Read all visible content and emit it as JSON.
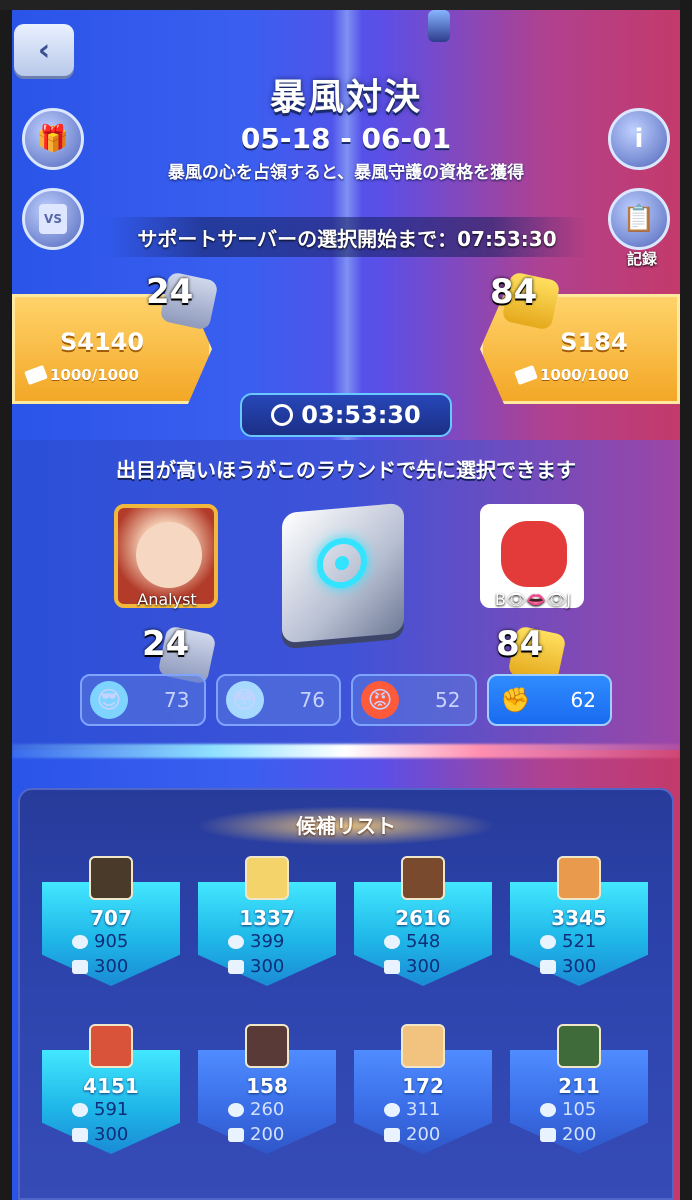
{
  "event": {
    "title": "暴風対決",
    "dates": "05-18 - 06-01",
    "subtitle": "暴風の心を占領すると、暴風守護の資格を獲得",
    "support_countdown": "サポートサーバーの選択開始まで：07:53:30",
    "record_label": "記録",
    "vs_label": "VS"
  },
  "servers": {
    "left": {
      "name": "S4140",
      "tickets": "1000/1000",
      "dice": "24"
    },
    "right": {
      "name": "S184",
      "tickets": "1000/1000",
      "dice": "84"
    }
  },
  "round_timer": "03:53:30",
  "round_note": "出目が高いほうがこのラウンドで先に選択できます",
  "players": {
    "left": {
      "name": "Analyst",
      "roll": "24"
    },
    "right": {
      "name": "B👁👄👁J",
      "roll": "84"
    }
  },
  "reactions": [
    {
      "icon": "cool-face-icon",
      "count": "73",
      "active": false
    },
    {
      "icon": "shocked-face-icon",
      "count": "76",
      "active": false
    },
    {
      "icon": "angry-face-icon",
      "count": "52",
      "active": false
    },
    {
      "icon": "fist-icon",
      "count": "62",
      "active": true
    }
  ],
  "candidate_list": {
    "title": "候補リスト",
    "cards": [
      {
        "id": "707",
        "medal": "905",
        "ticket": "300"
      },
      {
        "id": "1337",
        "medal": "399",
        "ticket": "300"
      },
      {
        "id": "2616",
        "medal": "548",
        "ticket": "300"
      },
      {
        "id": "3345",
        "medal": "521",
        "ticket": "300"
      },
      {
        "id": "4151",
        "medal": "591",
        "ticket": "300"
      },
      {
        "id": "158",
        "medal": "260",
        "ticket": "200"
      },
      {
        "id": "172",
        "medal": "311",
        "ticket": "200"
      },
      {
        "id": "211",
        "medal": "105",
        "ticket": "200"
      }
    ]
  },
  "colors": {
    "accent_gold": "#f3a726",
    "accent_cyan": "#33e3ff",
    "active_reaction": "#1a6bf0"
  }
}
